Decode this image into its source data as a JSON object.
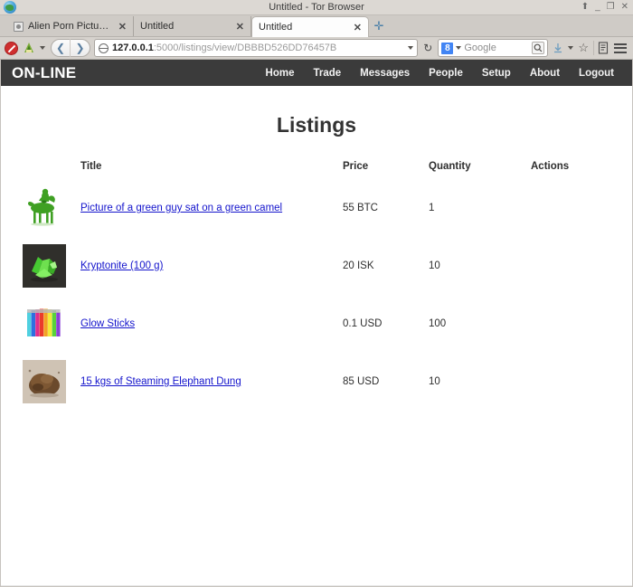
{
  "window": {
    "title": "Untitled - Tor Browser",
    "buttons": {
      "shade": "⬆",
      "minimize": "_",
      "maximize": "❐",
      "close": "✕"
    },
    "logo_icon": "tor-browser-logo-icon"
  },
  "tabs": [
    {
      "label": "Alien Porn Pictures, I...",
      "close": "✕",
      "active": false,
      "favicon": "page-favicon"
    },
    {
      "label": "Untitled",
      "close": "✕",
      "active": false,
      "favicon": ""
    },
    {
      "label": "Untitled",
      "close": "✕",
      "active": true,
      "favicon": ""
    }
  ],
  "newtab_label": "✛",
  "toolbar": {
    "noscript_icon": "noscript-icon",
    "torbutton_icon": "torbutton-onion-icon",
    "torbutton_caret": "▾",
    "back_arrow": "❮",
    "forward_arrow": "❯",
    "url_value": "127.0.0.1:5000/listings/view/DBBBD526DD76457B",
    "url_host": "127.0.0.1",
    "url_path": ":5000/listings/view/DBBBD526DD76457B",
    "url_caret": "▾",
    "reload_icon": "↻",
    "search_engine": "Google",
    "search_engine_badge": "8",
    "search_engine_caret": "▾",
    "search_placeholder": "Google",
    "search_go_icon": "🔍",
    "downloads_icon": "↴",
    "downloads_caret": "▾",
    "bookmark_star_icon": "☆",
    "reader_icon": "▤",
    "menu_icon": "hamburger-menu-icon"
  },
  "site": {
    "brand": "ON-LINE",
    "nav": [
      {
        "label": "Home"
      },
      {
        "label": "Trade"
      },
      {
        "label": "Messages"
      },
      {
        "label": "People"
      },
      {
        "label": "Setup"
      },
      {
        "label": "About"
      },
      {
        "label": "Logout"
      }
    ],
    "page_title": "Listings",
    "columns": {
      "thumb": "",
      "title": "Title",
      "price": "Price",
      "quantity": "Quantity",
      "actions": "Actions"
    },
    "rows": [
      {
        "thumb_name": "green-camel-thumbnail",
        "title": "Picture of a green guy sat on a green camel",
        "price": "55 BTC",
        "quantity": "1",
        "actions": ""
      },
      {
        "thumb_name": "kryptonite-crystals-thumbnail",
        "title": "Kryptonite (100 g)",
        "price": "20 ISK",
        "quantity": "10",
        "actions": ""
      },
      {
        "thumb_name": "glow-sticks-thumbnail",
        "title": "Glow Sticks",
        "price": "0.1 USD",
        "quantity": "100",
        "actions": ""
      },
      {
        "thumb_name": "elephant-dung-thumbnail",
        "title": "15 kgs of Steaming Elephant Dung",
        "price": "85 USD",
        "quantity": "10",
        "actions": ""
      }
    ]
  },
  "colors": {
    "navbar_bg": "#3b3b3b",
    "link": "#1414cc",
    "chrome_bg": "#d6d2cd",
    "active_tab_bg": "#fdfdfd",
    "noscript_red": "#cf2e2e",
    "google_blue": "#4285f4"
  }
}
